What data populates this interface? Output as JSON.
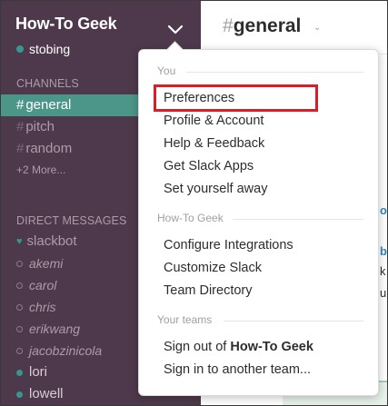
{
  "team": {
    "name": "How-To Geek",
    "user": "stobing"
  },
  "sidebar": {
    "channels_title": "CHANNELS",
    "channels": [
      {
        "name": "general",
        "active": true
      },
      {
        "name": "pitch",
        "active": false
      },
      {
        "name": "random",
        "active": false
      }
    ],
    "more_label": "+2 More...",
    "dm_title": "DIRECT MESSAGES",
    "direct_messages": [
      {
        "name": "slackbot",
        "status": "bot"
      },
      {
        "name": "akemi",
        "status": "away"
      },
      {
        "name": "carol",
        "status": "away"
      },
      {
        "name": "chris",
        "status": "away"
      },
      {
        "name": "erikwang",
        "status": "away"
      },
      {
        "name": "jacobzinicola",
        "status": "away"
      },
      {
        "name": "lori",
        "status": "online"
      },
      {
        "name": "lowell",
        "status": "online"
      }
    ],
    "hash": "#"
  },
  "main": {
    "channel_title": "general",
    "hash": "#",
    "caret": "⌄"
  },
  "menu": {
    "section_you": "You",
    "preferences": "Preferences",
    "profile_account": "Profile & Account",
    "help_feedback": "Help & Feedback",
    "get_apps": "Get Slack Apps",
    "set_away": "Set yourself away",
    "section_team": "How-To Geek",
    "configure_integrations": "Configure Integrations",
    "customize_slack": "Customize Slack",
    "team_directory": "Team Directory",
    "section_teams": "Your teams",
    "sign_out_prefix": "Sign out of ",
    "sign_out_team": "How-To Geek",
    "sign_in_other": "Sign in to another team..."
  },
  "colors": {
    "sidebar_bg": "#4d394b",
    "active_channel": "#4c9689",
    "highlight": "#e01b24"
  }
}
